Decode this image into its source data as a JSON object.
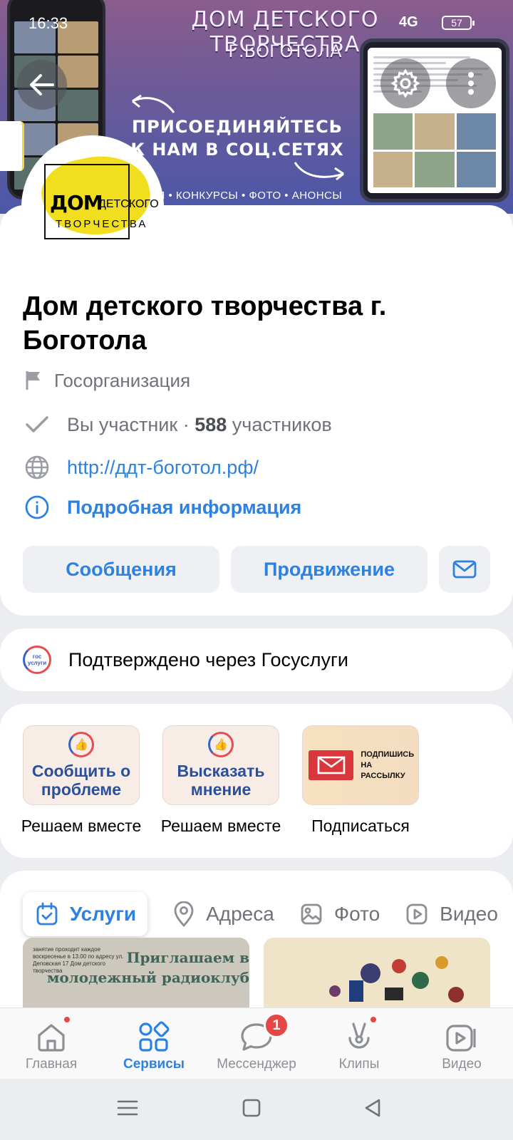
{
  "status_bar": {
    "time": "16:33",
    "network": "4G",
    "battery": "57"
  },
  "cover": {
    "title": "ДОМ ДЕТСКОГО ТВОРЧЕСТВА",
    "subtitle": "Г.БОГОТОЛА",
    "join_line1": "ПРИСОЕДИНЯЙТЕСЬ",
    "join_line2": "К НАМ В СОЦ.СЕТЯХ",
    "tags": "СТИ • КОНКУРСЫ • ФОТО • АНОНСЫ"
  },
  "avatar": {
    "line1": "ДОМ",
    "line2": "ДЕТСКОГО",
    "line3": "ТВОРЧЕСТВА"
  },
  "group": {
    "name": "Дом детского творчества г. Боготола",
    "category": "Госорганизация",
    "member_status": "Вы участник",
    "separator": "·",
    "members_count": "588",
    "members_label": "участников",
    "website": "http://ддт-боготол.рф/",
    "details_link": "Подробная информация"
  },
  "actions": {
    "messages": "Сообщения",
    "promotion": "Продвижение"
  },
  "verification": {
    "logo_text": "гос услуги",
    "text": "Подтверждено через Госуслуги"
  },
  "widgets": [
    {
      "title": "Сообщить о проблеме",
      "caption": "Решаем вместе"
    },
    {
      "title": "Высказать мнение",
      "caption": "Решаем вместе"
    },
    {
      "title": "ПОДПИШИСЬ НА РАССЫЛКУ",
      "caption": "Подписаться"
    }
  ],
  "tabs": [
    "Услуги",
    "Адреса",
    "Фото",
    "Видео"
  ],
  "banners": {
    "first_small": "занятие проходит каждое воскресенье в 13.00 по адресу ул. Деповская 17 Дом детского творчества",
    "first_big": "Приглашаем в молодежный радиоклуб"
  },
  "bottom_nav": [
    {
      "label": "Главная"
    },
    {
      "label": "Сервисы"
    },
    {
      "label": "Мессенджер",
      "badge": "1"
    },
    {
      "label": "Клипы"
    },
    {
      "label": "Видео"
    }
  ],
  "colors": {
    "accent": "#2d81e0",
    "badge": "#e64646",
    "text_secondary": "#6f7278"
  }
}
